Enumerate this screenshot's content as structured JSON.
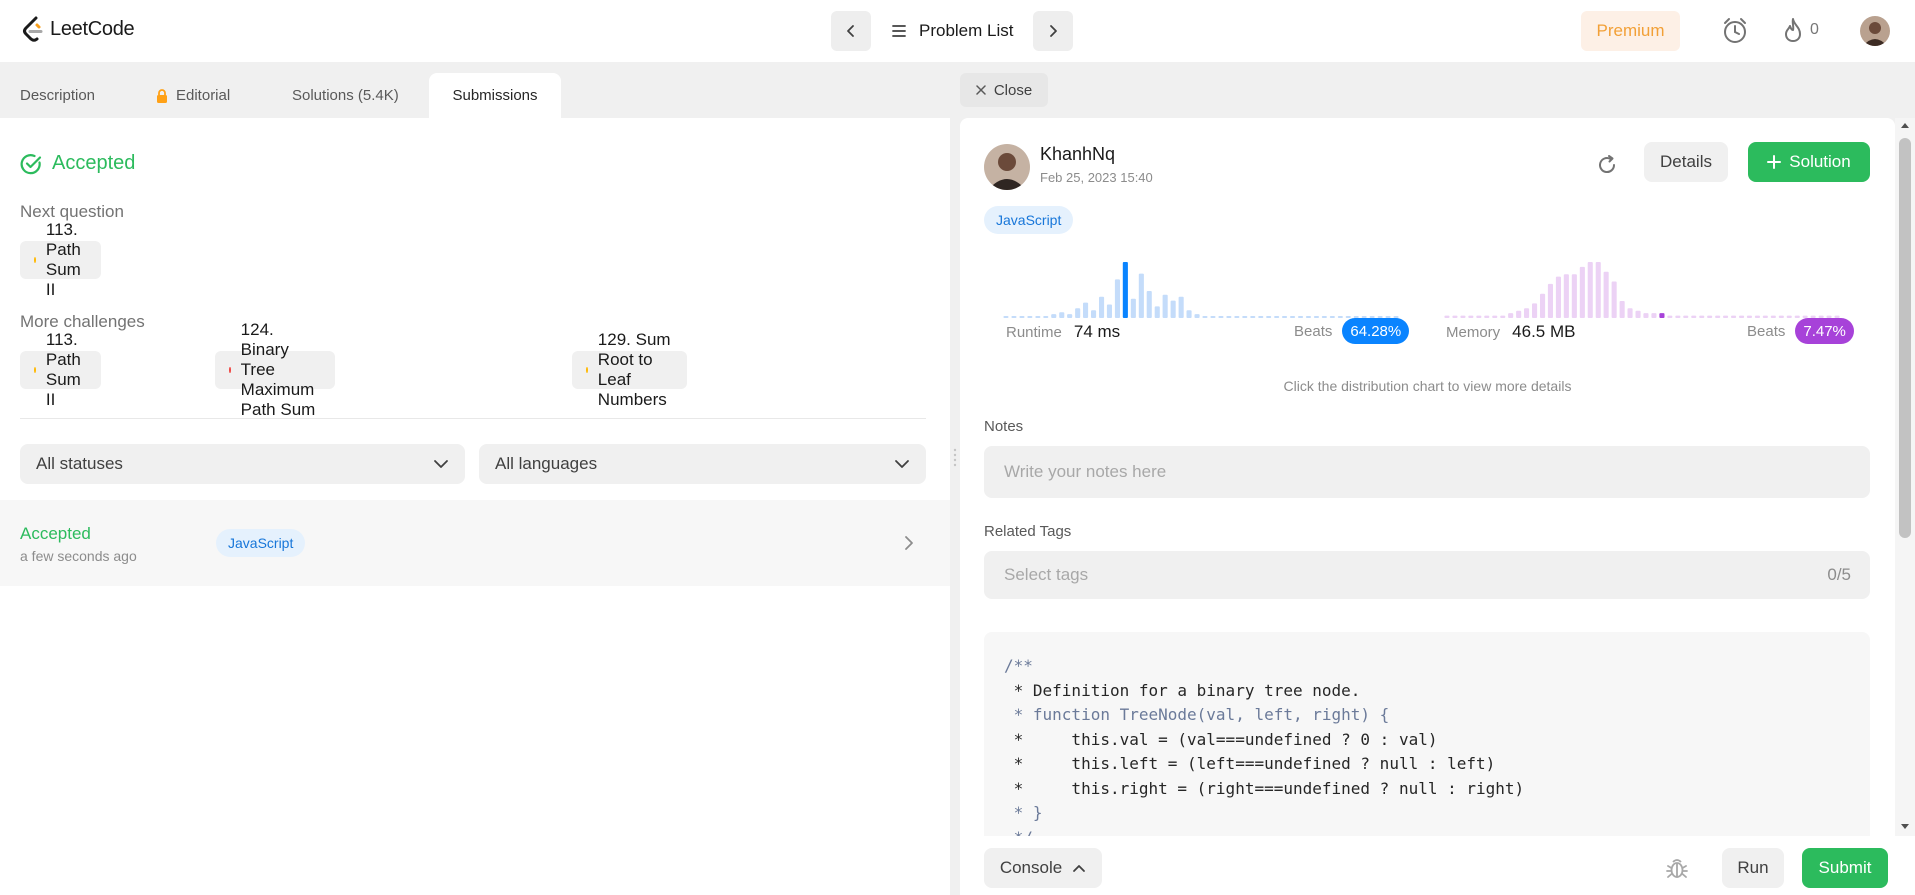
{
  "app": {
    "name": "LeetCode"
  },
  "topnav": {
    "problem_list_label": "Problem List",
    "premium_label": "Premium",
    "streak_count": "0"
  },
  "left": {
    "tabs": [
      {
        "label": "Description"
      },
      {
        "label": "Editorial"
      },
      {
        "label": "Solutions (5.4K)"
      },
      {
        "label": "Submissions"
      }
    ],
    "result_title": "Accepted",
    "next_question_label": "Next question",
    "next_question": {
      "label": "113. Path Sum II",
      "difficulty_color": "#ffb800"
    },
    "more_challenges_label": "More challenges",
    "more_challenges": [
      {
        "label": "113. Path Sum II",
        "difficulty_color": "#ffb800"
      },
      {
        "label": "124. Binary Tree Maximum Path Sum",
        "difficulty_color": "#ef4743"
      },
      {
        "label": "129. Sum Root to Leaf Numbers",
        "difficulty_color": "#ffb800"
      }
    ],
    "filters": {
      "status": "All statuses",
      "language": "All languages"
    },
    "submissions": [
      {
        "status": "Accepted",
        "time": "a few seconds ago",
        "language": "JavaScript"
      }
    ]
  },
  "right": {
    "close_label": "Close",
    "user": {
      "name": "KhanhNq",
      "date": "Feb 25, 2023 15:40"
    },
    "details_label": "Details",
    "solution_label": "Solution",
    "language": "JavaScript",
    "runtime": {
      "label": "Runtime",
      "value": "74 ms",
      "beats_label": "Beats",
      "beats": "64.28%",
      "color": "#0a84ff",
      "light_color": "#c4dcfa",
      "distribution": [
        1,
        1,
        1,
        1,
        1,
        1,
        2,
        3,
        2,
        5,
        8,
        4,
        11,
        7,
        20,
        29,
        10,
        23,
        14,
        6,
        12,
        9,
        11,
        4,
        2,
        1,
        1,
        1,
        1,
        1,
        1,
        1,
        1,
        1,
        1,
        1,
        1,
        1,
        1,
        1,
        1,
        1,
        1,
        1,
        1,
        1,
        1,
        1,
        1,
        1
      ],
      "selected_index": 15
    },
    "memory": {
      "label": "Memory",
      "value": "46.5 MB",
      "beats_label": "Beats",
      "beats": "7.47%",
      "color": "#a742d9",
      "light_color": "#ecd2f5",
      "distribution": [
        1,
        1,
        1,
        1,
        1,
        1,
        1,
        1,
        2,
        3,
        4,
        6,
        10,
        14,
        17,
        18,
        18,
        21,
        23,
        23,
        19,
        15,
        7,
        4,
        3,
        2,
        2,
        2,
        1,
        1,
        1,
        1,
        1,
        1,
        1,
        1,
        1,
        1,
        1,
        1,
        1,
        1,
        1,
        1,
        1,
        1,
        1,
        1,
        1,
        1
      ],
      "selected_index": 27
    },
    "chart_hint": "Click the distribution chart to view more details",
    "notes_label": "Notes",
    "notes_placeholder": "Write your notes here",
    "tags_label": "Related Tags",
    "tags_placeholder": "Select tags",
    "tags_count": "0/5",
    "code_lines": [
      "/**",
      " * Definition for a binary tree node.",
      " * function TreeNode(val, left, right) {",
      " *     this.val = (val===undefined ? 0 : val)",
      " *     this.left = (left===undefined ? null : left)",
      " *     this.right = (right===undefined ? null : right)",
      " * }",
      " */"
    ]
  },
  "bottom": {
    "console_label": "Console",
    "run_label": "Run",
    "submit_label": "Submit"
  }
}
